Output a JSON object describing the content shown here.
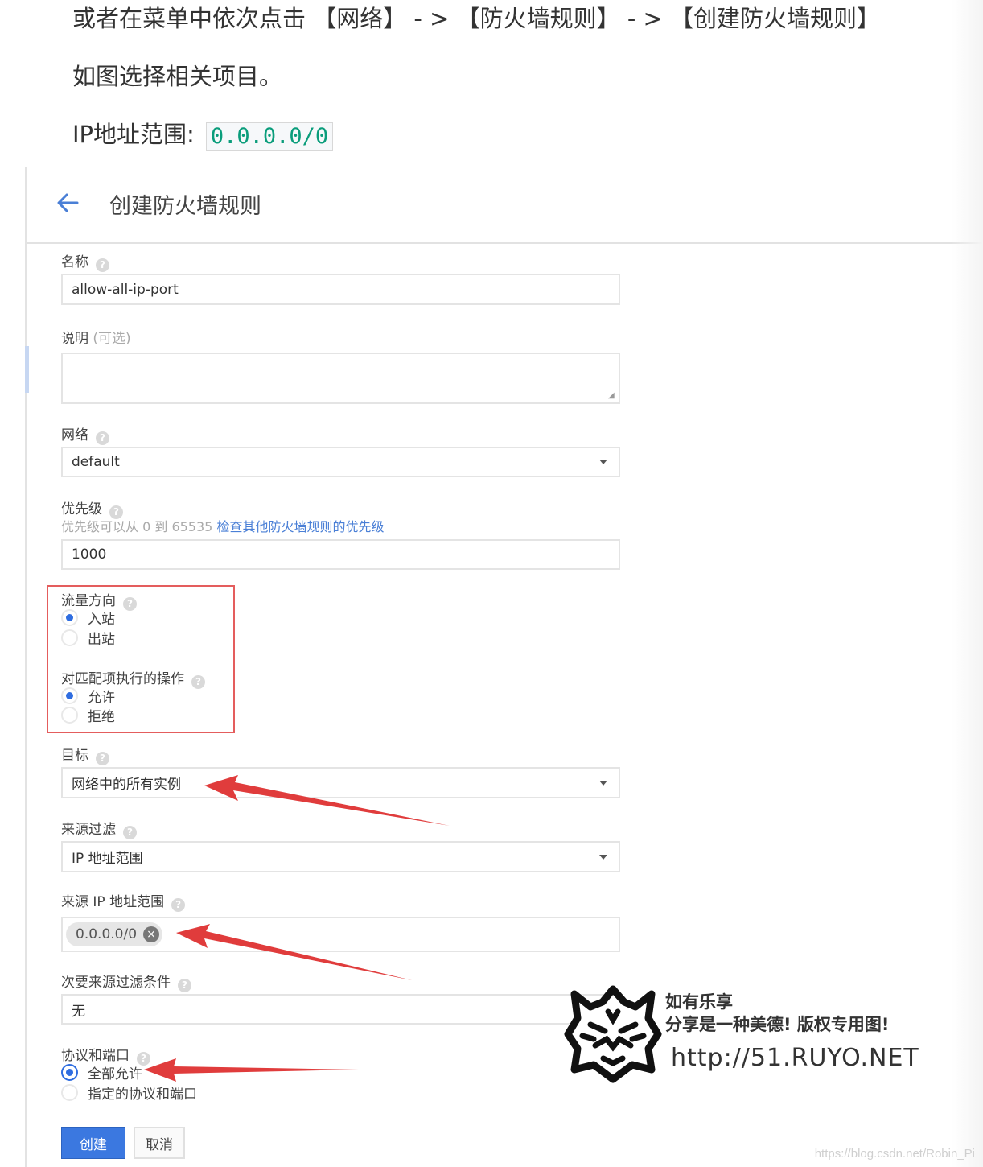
{
  "article": {
    "line1": "或者在菜单中依次点击 【网络】 - > 【防火墙规则】 - > 【创建防火墙规则】",
    "line2": "如图选择相关项目。",
    "line3_label": "IP地址范围:",
    "line3_code": "0.0.0.0/0"
  },
  "screenshot": {
    "title": "创建防火墙规则",
    "name_label": "名称",
    "name_value": "allow-all-ip-port",
    "desc_label": "说明",
    "desc_optional": "(可选)",
    "network_label": "网络",
    "network_value": "default",
    "priority_label": "优先级",
    "priority_hint": "优先级可以从 0 到 65535",
    "priority_link": "检查其他防火墙规则的优先级",
    "priority_value": "1000",
    "direction_label": "流量方向",
    "direction_options": [
      "入站",
      "出站"
    ],
    "action_label": "对匹配项执行的操作",
    "action_options": [
      "允许",
      "拒绝"
    ],
    "target_label": "目标",
    "target_value": "网络中的所有实例",
    "source_filter_label": "来源过滤",
    "source_filter_value": "IP 地址范围",
    "source_ip_label": "来源 IP 地址范围",
    "source_ip_chip": "0.0.0.0/0",
    "secondary_filter_label": "次要来源过滤条件",
    "secondary_filter_value": "无",
    "protocol_label": "协议和端口",
    "protocol_options": [
      "全部允许",
      "指定的协议和端口"
    ],
    "create_button": "创建",
    "cancel_button": "取消"
  },
  "watermark": {
    "line1": "如有乐享",
    "line2": "分享是一种美德! 版权专用图!",
    "url": "http://51.RUYO.NET",
    "csdn": "https://blog.csdn.net/Robin_Pi"
  },
  "colors": {
    "accent_blue": "#3b78e0",
    "link_blue": "#4a7fd6",
    "annotation_red": "#e03c3c",
    "code_green": "#0a9d7b"
  }
}
